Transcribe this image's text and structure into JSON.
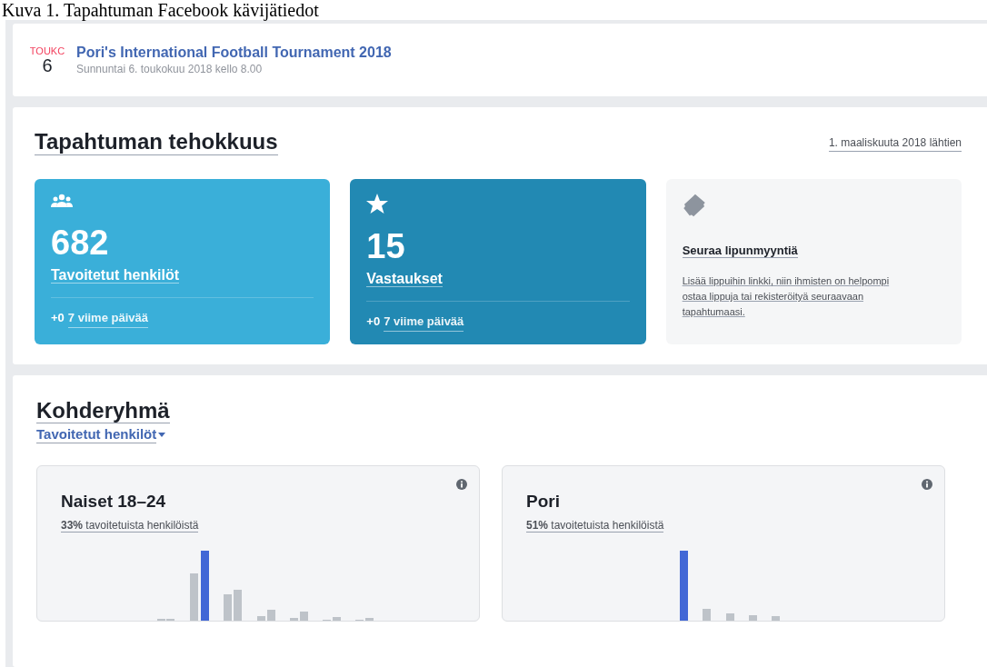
{
  "caption": "Kuva 1. Tapahtuman Facebook kävijätiedot",
  "event": {
    "month": "TOUKC",
    "day": "6",
    "title": "Pori's International Football Tournament 2018",
    "date": "Sunnuntai 6. toukokuu 2018 kello 8.00"
  },
  "performance": {
    "title": "Tapahtuman tehokkuus",
    "range": "1. maaliskuuta 2018 lähtien",
    "cards": [
      {
        "kind": "people",
        "value": "682",
        "label": "Tavoitetut henkilöt",
        "change": "+0",
        "period": "7 viime päivää"
      },
      {
        "kind": "responses",
        "value": "15",
        "label": "Vastaukset",
        "change": "+0",
        "period": "7 viime päivää"
      }
    ],
    "tickets": {
      "title": "Seuraa lipunmyyntiä",
      "text": "Lisää lippuihin linkki, niin ihmisten on helpompi ostaa lippuja tai rekisteröityä seuraavaan tapahtumaasi."
    }
  },
  "audience": {
    "title": "Kohderyhmä",
    "metric": "Tavoitetut henkilöt",
    "cards": [
      {
        "title": "Naiset 18–24",
        "share": "**33%** tavoitetuista henkilöistä"
      },
      {
        "title": "Pori",
        "share": "**51%** tavoitetuista henkilöistä"
      }
    ]
  }
}
